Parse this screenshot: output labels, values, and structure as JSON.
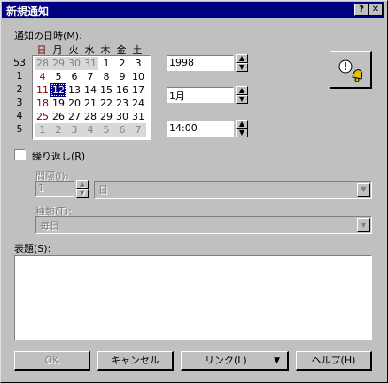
{
  "window": {
    "title": "新規通知",
    "help_btn": "?",
    "close_btn": "✕"
  },
  "datetime_label": "通知の日時(M):",
  "calendar": {
    "weekdays": [
      "日",
      "月",
      "火",
      "水",
      "木",
      "金",
      "土"
    ],
    "week_numbers": [
      "53",
      "1",
      "2",
      "3",
      "4",
      "5"
    ],
    "rows": [
      [
        "28",
        "29",
        "30",
        "31",
        "1",
        "2",
        "3"
      ],
      [
        "4",
        "5",
        "6",
        "7",
        "8",
        "9",
        "10"
      ],
      [
        "11",
        "12",
        "13",
        "14",
        "15",
        "16",
        "17"
      ],
      [
        "18",
        "19",
        "20",
        "21",
        "22",
        "23",
        "24"
      ],
      [
        "25",
        "26",
        "27",
        "28",
        "29",
        "30",
        "31"
      ],
      [
        "1",
        "2",
        "3",
        "4",
        "5",
        "6",
        "7"
      ]
    ],
    "selected": "12"
  },
  "year_value": "1998",
  "month_value": "1月",
  "time_value": "14:00",
  "repeat_label": "繰り返し(R)",
  "interval_label": "間隔(I):",
  "interval_value": "1",
  "interval_unit": "日",
  "type_label": "種類(T):",
  "type_value": "毎日",
  "subject_label": "表題(S):",
  "buttons": {
    "ok": "OK",
    "cancel": "キャンセル",
    "link": "リンク(L)",
    "help": "ヘルプ(H)"
  },
  "colors": {
    "titlebar": "#000080",
    "sunday": "#800000",
    "selected_bg": "#000080"
  }
}
